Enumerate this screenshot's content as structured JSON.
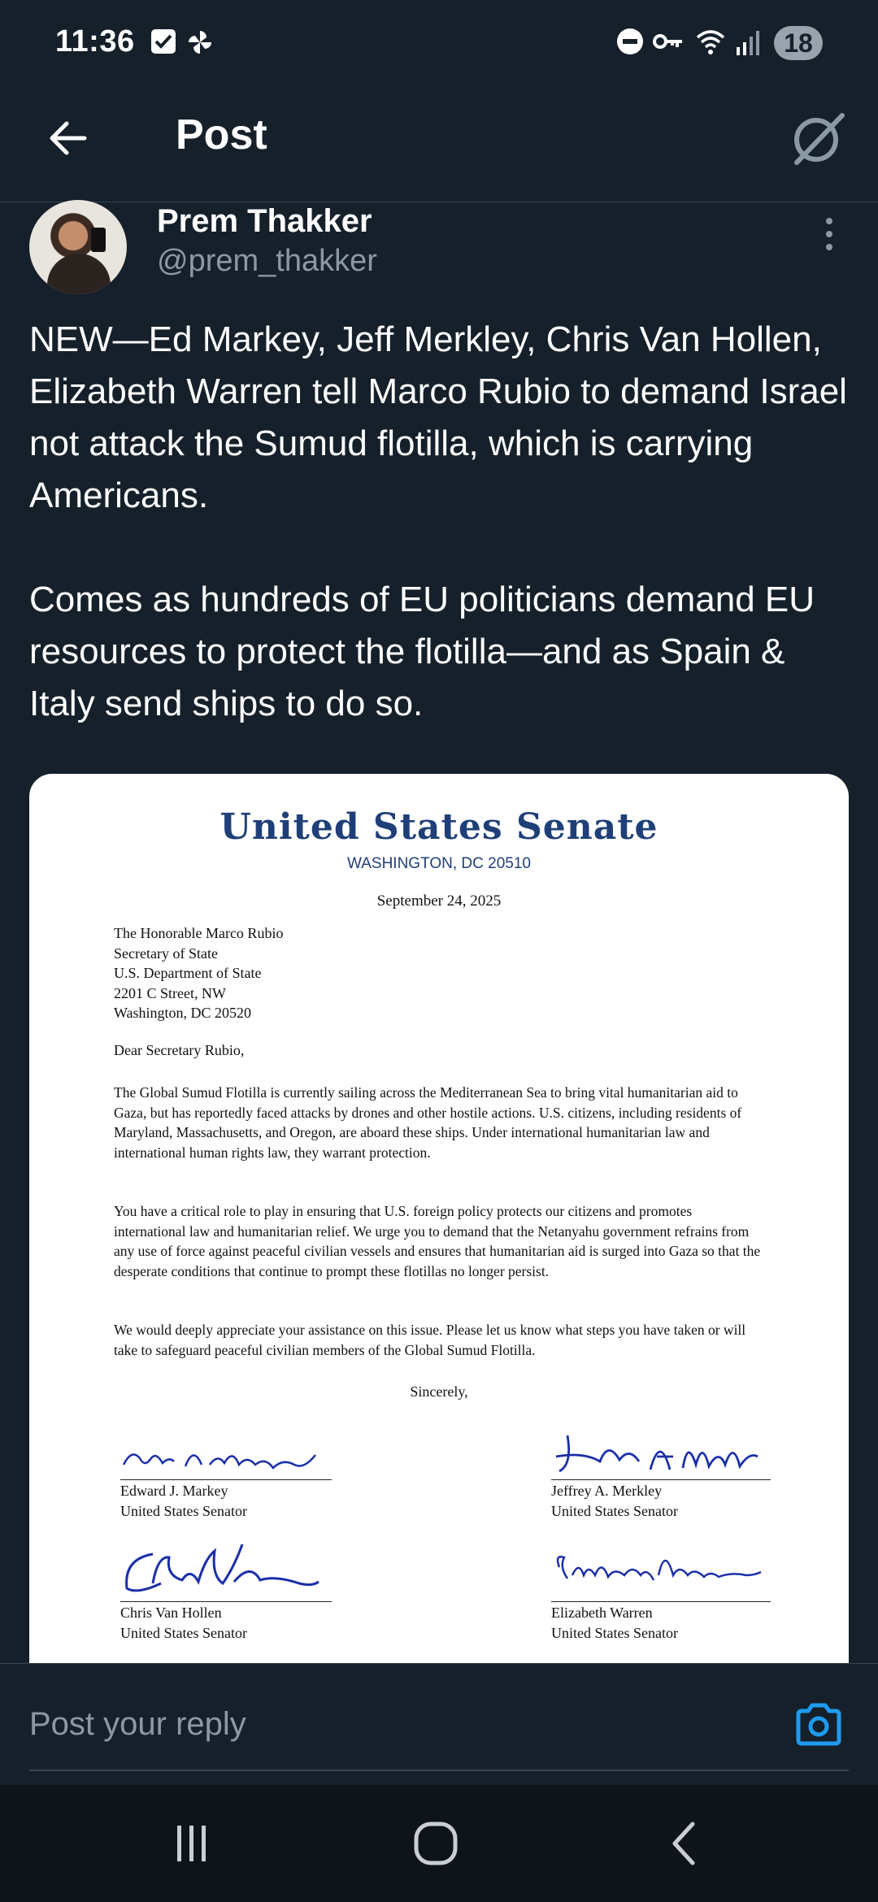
{
  "status_bar": {
    "time": "11:36",
    "battery": "18"
  },
  "header": {
    "title": "Post"
  },
  "author": {
    "name": "Prem Thakker",
    "handle": "@prem_thakker"
  },
  "tweet": {
    "paragraph1": "NEW—Ed Markey, Jeff Merkley, Chris Van Hollen, Elizabeth Warren tell Marco Rubio to demand Israel not attack the Sumud flotilla, which is carrying Americans.",
    "paragraph2": "Comes as hundreds of EU politicians demand EU resources to protect the flotilla—and as Spain & Italy send ships to do so."
  },
  "letter": {
    "heading": "United States Senate",
    "location": "WASHINGTON, DC 20510",
    "date": "September 24, 2025",
    "address": [
      "The Honorable Marco Rubio",
      "Secretary of State",
      "U.S. Department of State",
      "2201 C Street, NW",
      "Washington, DC 20520"
    ],
    "salutation": "Dear Secretary Rubio,",
    "paragraph1": "The Global Sumud Flotilla is currently sailing across the Mediterranean Sea to bring vital humanitarian aid to Gaza, but has reportedly faced attacks by drones and other hostile actions. U.S. citizens, including residents of Maryland, Massachusetts, and Oregon, are aboard these ships. Under international humanitarian law and international human rights law, they warrant protection.",
    "paragraph2": "You have a critical role to play in ensuring that U.S. foreign policy protects our citizens and promotes international law and humanitarian relief. We urge you to demand that the Netanyahu government refrains from any use of force against peaceful civilian vessels and ensures that humanitarian aid is surged into Gaza so that the desperate conditions that continue to prompt these flotillas no longer persist.",
    "paragraph3": "We would deeply appreciate your assistance on this issue. Please let us know what steps you have taken or will take to safeguard peaceful civilian members of the Global Sumud Flotilla.",
    "closing": "Sincerely,",
    "signatories": [
      {
        "name": "Edward J. Markey",
        "title": "United States Senator"
      },
      {
        "name": "Jeffrey A. Merkley",
        "title": "United States Senator"
      },
      {
        "name": "Chris Van Hollen",
        "title": "United States Senator"
      },
      {
        "name": "Elizabeth Warren",
        "title": "United States Senator"
      }
    ]
  },
  "reply": {
    "placeholder": "Post your reply"
  },
  "icons": {
    "back": "arrow-left-icon",
    "grok": "grok-icon",
    "more": "more-vertical-icon",
    "camera": "camera-icon",
    "recents": "recents-icon",
    "home": "home-icon",
    "nav_back": "back-chevron-icon"
  },
  "colors": {
    "background": "#15202b",
    "accent": "#1d9bf0",
    "secondary_text": "#8b98a5",
    "letterhead": "#1f3f78"
  }
}
